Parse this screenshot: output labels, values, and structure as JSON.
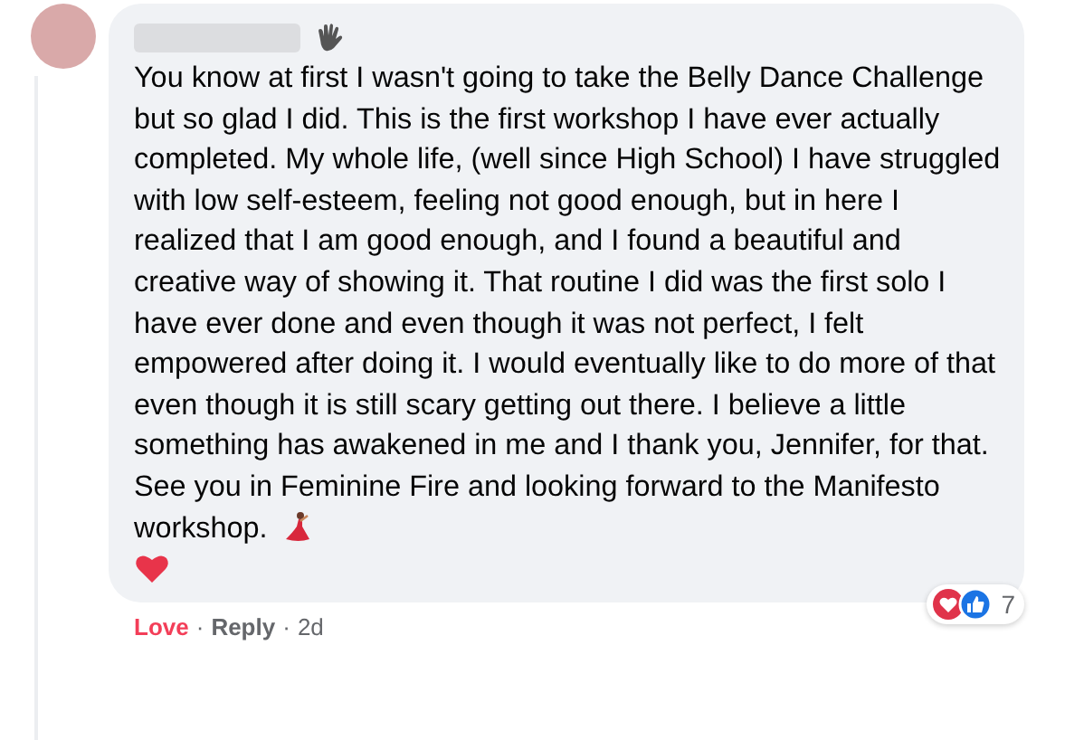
{
  "comment": {
    "text": "You know at first I wasn't going to take the Belly Dance Challenge but so glad I did. This is the first workshop I have ever actually completed. My whole life, (well since High School) I have struggled with low self-esteem, feeling not good enough, but in here I realized that I am good enough, and I found a beautiful and creative way of showing it. That routine I did was the first solo I have ever done and even though it was not perfect, I felt empowered after doing it. I would eventually like to do more of that even though it is still scary getting out there. I believe a little something has awakened in me and I thank you, Jennifer, for that. See you in Feminine Fire and looking forward to the Manifesto workshop.",
    "reaction_count": "7"
  },
  "actions": [
    {
      "kind": "react",
      "label": "Love",
      "selected": true
    },
    {
      "kind": "reply",
      "label": "Reply"
    }
  ],
  "separators": [
    "·",
    "·"
  ],
  "time": "2d"
}
